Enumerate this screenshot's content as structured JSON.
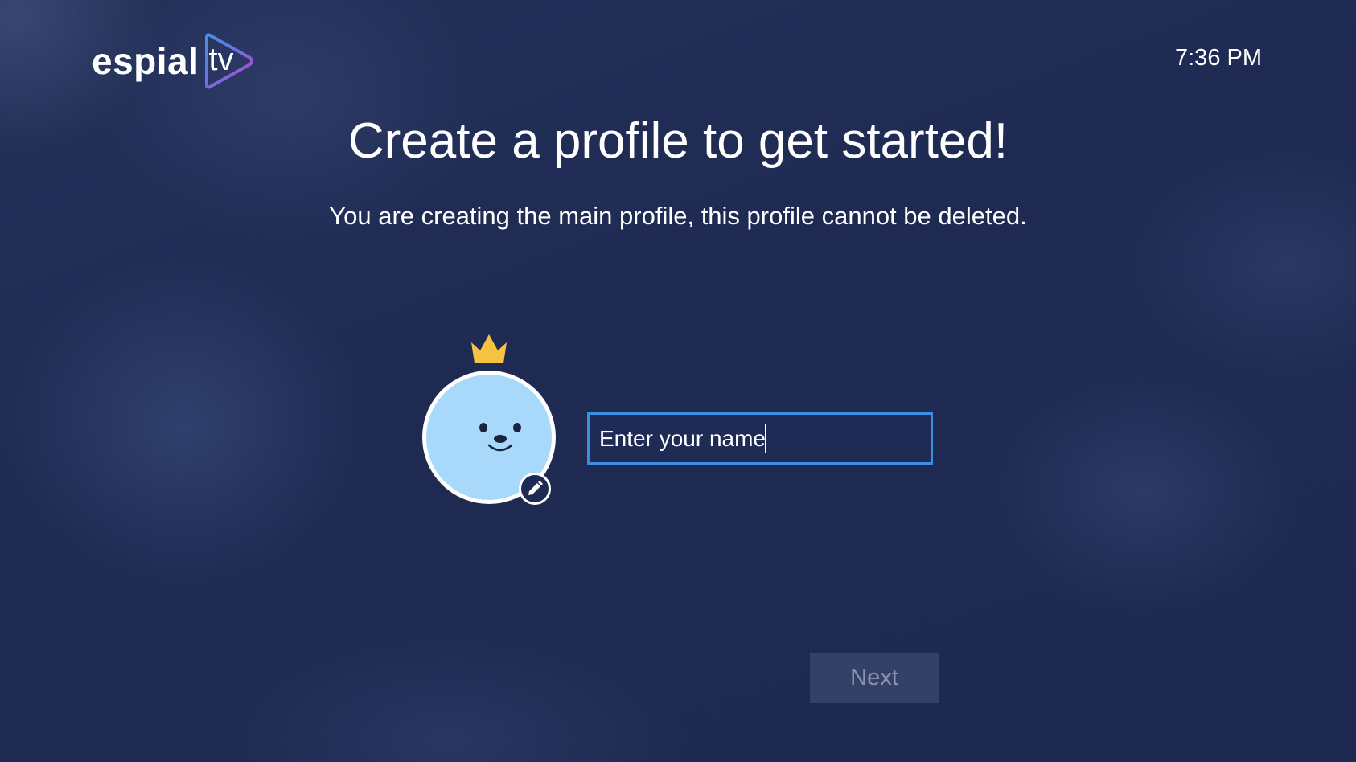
{
  "header": {
    "logo_word": "espial",
    "logo_tv": "tv",
    "clock": "7:36 PM"
  },
  "main": {
    "title": "Create a profile to get started!",
    "subtitle": "You are creating the main profile, this profile cannot be deleted.",
    "avatar": {
      "icon": "face-icon",
      "badge_icon": "crown-icon",
      "edit_icon": "pencil-icon",
      "color": "#a8d8fa"
    },
    "name_input": {
      "placeholder": "Enter your name",
      "value": ""
    },
    "next_label": "Next"
  },
  "colors": {
    "accent": "#3b8fdf",
    "crown": "#f5c242",
    "background": "#1e2a52"
  }
}
